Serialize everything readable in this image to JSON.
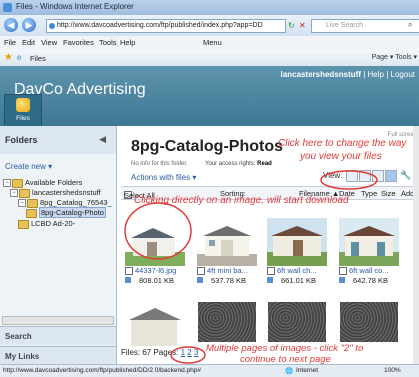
{
  "browser": {
    "window_title": "Files - Windows Internet Explorer",
    "url": "http://www.davcoadvertising.com/ftp/published/index.php?app=DD",
    "search_placeholder": "Live Search",
    "menu": [
      "File",
      "Edit",
      "View",
      "Favorites",
      "Tools",
      "Help",
      "Menu"
    ],
    "tab_label": "Files",
    "tools_bar": "Page ▾  Tools ▾",
    "status_url": "http://www.davcoadvertising.com/ftp/published/DD/2.0/backend.php#",
    "status_zone": "Internet",
    "zoom": "100%"
  },
  "app": {
    "brand": "DavCo Advertising",
    "user": "lancastershedsnstuff",
    "help": "Help",
    "logout": "Logout",
    "files_button": "Files"
  },
  "sidebar": {
    "header": "Folders",
    "create_new": "Create new ▾",
    "tree": [
      {
        "label": "Available Folders"
      },
      {
        "label": "lancastershedsnstuff"
      },
      {
        "label": "8pg_Catalog_76543_"
      },
      {
        "label": "8pg-Catalog-Photo"
      },
      {
        "label": "LCBD Ad-20-"
      }
    ],
    "search": "Search",
    "my_links": "My Links"
  },
  "main": {
    "full_screen": "Full screen",
    "title": "8pg-Catalog-Photos",
    "no_info": "No info for this folder.",
    "access_label": "Your access rights:",
    "access_value": "Read",
    "actions": "Actions with files ▾",
    "view_label": "View:",
    "columns": {
      "select_all": "Select All",
      "sorting": "Sorting:",
      "filename": "Filename ▲",
      "date": "Date",
      "type": "Type",
      "size": "Size",
      "added_by": "Added by"
    },
    "files": [
      {
        "name": "44337-l6.jpg",
        "size": "808.01 KB"
      },
      {
        "name": "4ft mini ba...",
        "size": "537.78 KB"
      },
      {
        "name": "6ft wall ch...",
        "size": "661.01 KB"
      },
      {
        "name": "6ft wall co...",
        "size": "642.78 KB"
      }
    ],
    "files_count": "Files: 67",
    "pages_label": "Pages:",
    "pages": [
      "1",
      "2",
      "3"
    ]
  },
  "annotations": {
    "view_tip_1": "Click here to change the way",
    "view_tip_2": "you view your files",
    "download_tip": "Clicking directly on an image, will start download",
    "pages_tip_1": "Multiple pages of images - click \"2\" to",
    "pages_tip_2": "continue to next page"
  },
  "colors": {
    "header": "#4b86a3",
    "annotation": "#e03a3a",
    "link": "#2a5aa5"
  }
}
